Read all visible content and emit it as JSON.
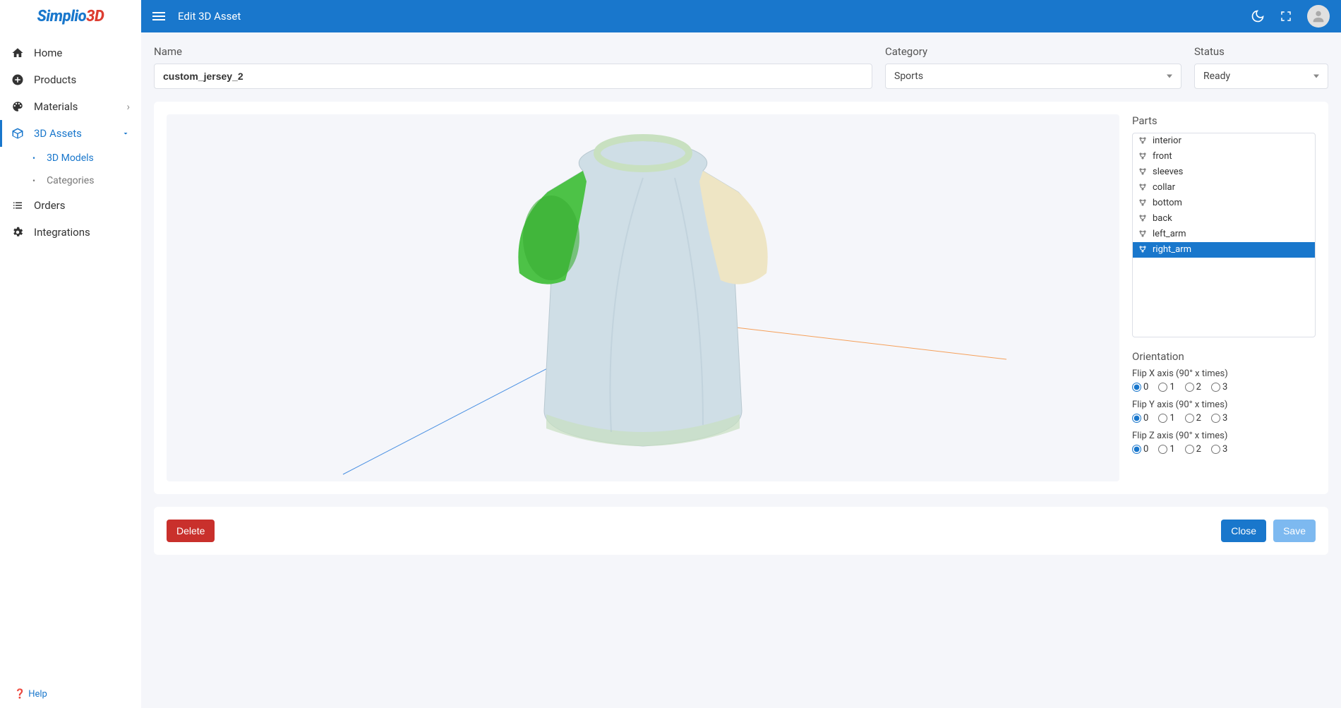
{
  "brand": {
    "part1": "Simplio",
    "part2": "3D"
  },
  "topbar": {
    "title": "Edit 3D Asset"
  },
  "sidebar": {
    "items": [
      {
        "label": "Home",
        "icon": "home"
      },
      {
        "label": "Products",
        "icon": "plus"
      },
      {
        "label": "Materials",
        "icon": "palette",
        "expandable": true
      },
      {
        "label": "3D Assets",
        "icon": "cube",
        "expandable": true,
        "active": true
      },
      {
        "label": "Orders",
        "icon": "list"
      },
      {
        "label": "Integrations",
        "icon": "gear"
      }
    ],
    "assets_sub": [
      {
        "label": "3D Models",
        "active": true
      },
      {
        "label": "Categories",
        "active": false
      }
    ],
    "help": "Help"
  },
  "form": {
    "name_label": "Name",
    "name_value": "custom_jersey_2",
    "category_label": "Category",
    "category_value": "Sports",
    "status_label": "Status",
    "status_value": "Ready"
  },
  "parts": {
    "title": "Parts",
    "items": [
      "interior",
      "front",
      "sleeves",
      "collar",
      "bottom",
      "back",
      "left_arm",
      "right_arm"
    ],
    "selected": "right_arm"
  },
  "orientation": {
    "title": "Orientation",
    "axes": [
      {
        "label": "Flip X axis (90° x times)",
        "key": "x",
        "value": "0"
      },
      {
        "label": "Flip Y axis (90° x times)",
        "key": "y",
        "value": "0"
      },
      {
        "label": "Flip Z axis (90° x times)",
        "key": "z",
        "value": "0"
      }
    ],
    "options": [
      "0",
      "1",
      "2",
      "3"
    ]
  },
  "footer": {
    "delete": "Delete",
    "close": "Close",
    "save": "Save"
  }
}
